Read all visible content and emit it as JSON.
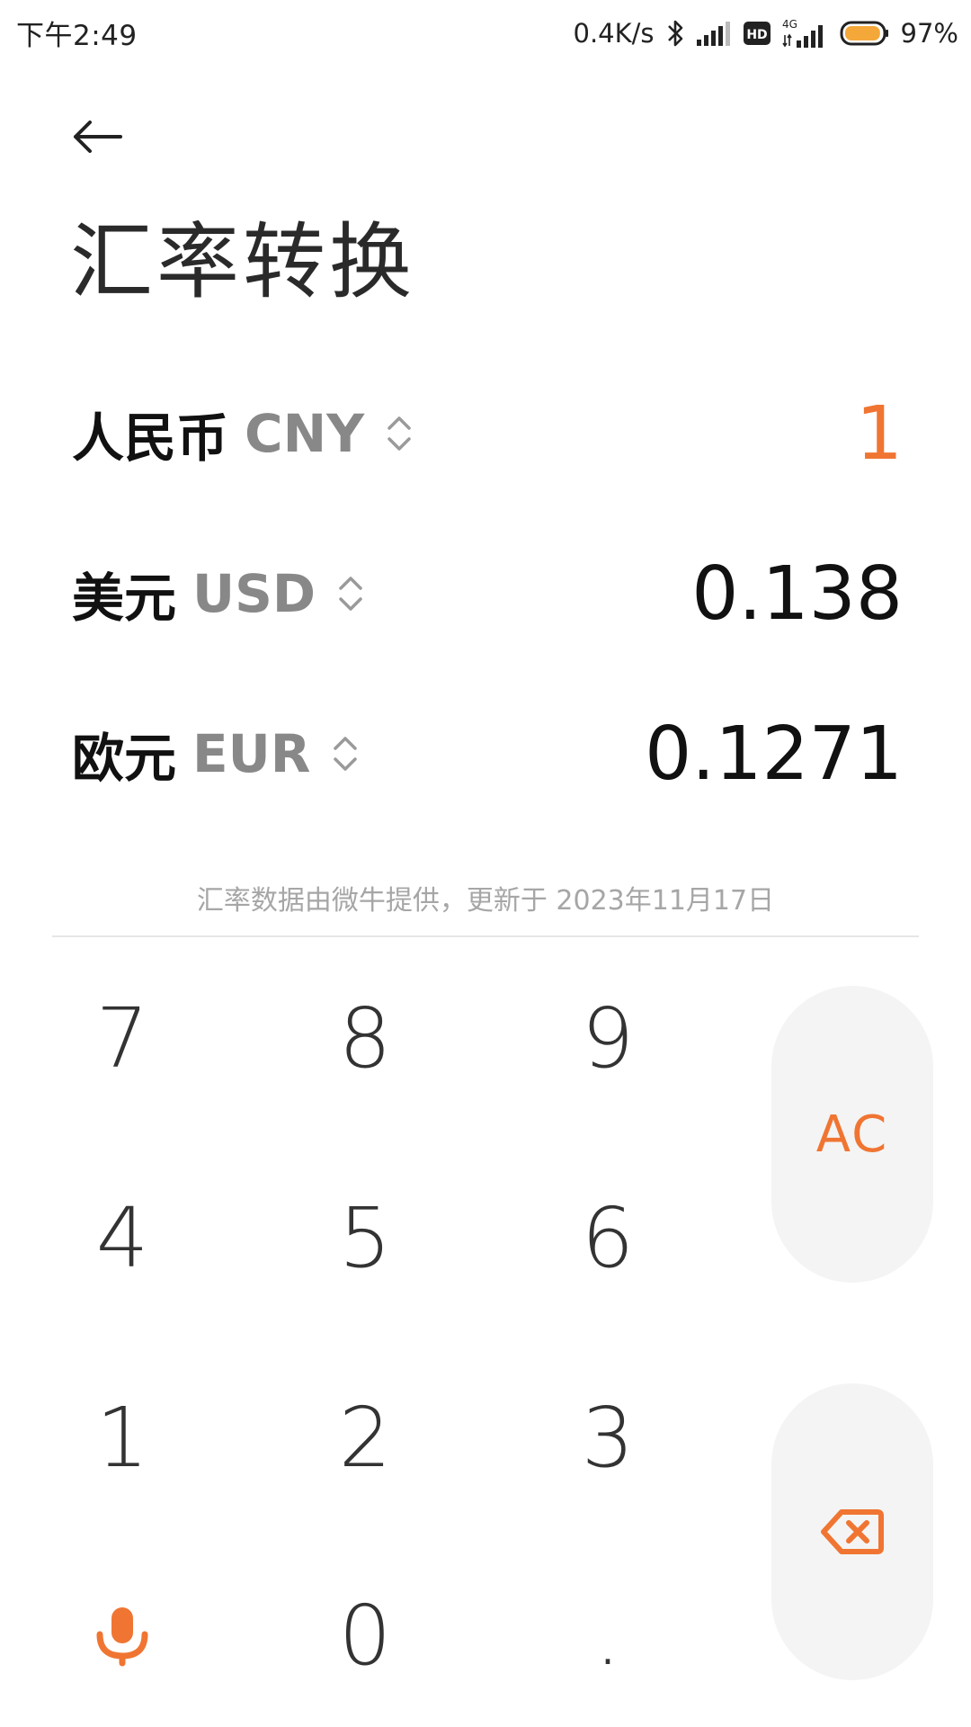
{
  "status_bar": {
    "time": "下午2:49",
    "net_speed": "0.4K/s",
    "hd_label": "HD",
    "net_type": "4G",
    "battery_percent": "97%",
    "battery_level": 0.97,
    "battery_color": "#f4a83a"
  },
  "header": {
    "title": "汇率转换"
  },
  "currencies": [
    {
      "name": "人民币",
      "code": "CNY",
      "value": "1"
    },
    {
      "name": "美元",
      "code": "USD",
      "value": "0.138"
    },
    {
      "name": "欧元",
      "code": "EUR",
      "value": "0.1271"
    }
  ],
  "rate_note": "汇率数据由微牛提供，更新于 2023年11月17日",
  "keypad": {
    "keys": [
      "7",
      "8",
      "9",
      "4",
      "5",
      "6",
      "1",
      "2",
      "3",
      "0",
      "."
    ],
    "clear_label": "AC"
  },
  "colors": {
    "accent": "#f07532",
    "code_gray": "#888888",
    "side_key_bg": "#f4f4f4"
  },
  "icons": [
    "back-arrow-icon",
    "chevron-updown-icon",
    "microphone-icon",
    "backspace-icon",
    "bluetooth-icon",
    "signal-icon",
    "battery-icon"
  ]
}
